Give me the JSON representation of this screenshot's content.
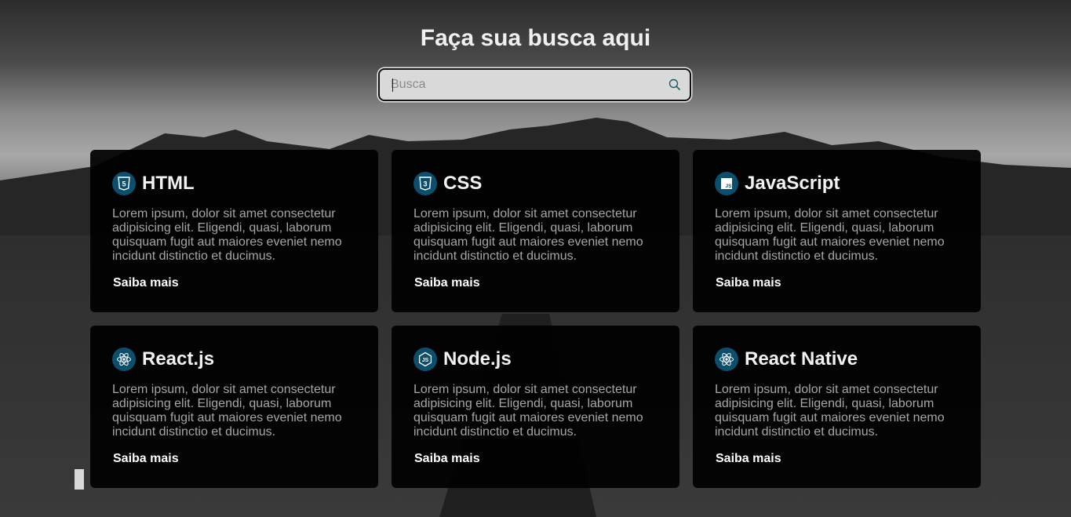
{
  "header": {
    "title": "Faça sua busca aqui"
  },
  "search": {
    "placeholder": "Busca",
    "value": "",
    "icon": "search-icon"
  },
  "cards": [
    {
      "title": "HTML",
      "icon": "html5-icon",
      "text": "Lorem ipsum, dolor sit amet consectetur adipisicing elit. Eligendi, quasi, laborum quisquam fugit aut maiores eveniet nemo incidunt distinctio et ducimus.",
      "link": "Saiba mais"
    },
    {
      "title": "CSS",
      "icon": "css3-icon",
      "text": "Lorem ipsum, dolor sit amet consectetur adipisicing elit. Eligendi, quasi, laborum quisquam fugit aut maiores eveniet nemo incidunt distinctio et ducimus.",
      "link": "Saiba mais"
    },
    {
      "title": "JavaScript",
      "icon": "javascript-icon",
      "text": "Lorem ipsum, dolor sit amet consectetur adipisicing elit. Eligendi, quasi, laborum quisquam fugit aut maiores eveniet nemo incidunt distinctio et ducimus.",
      "link": "Saiba mais"
    },
    {
      "title": "React.js",
      "icon": "react-icon",
      "text": "Lorem ipsum, dolor sit amet consectetur adipisicing elit. Eligendi, quasi, laborum quisquam fugit aut maiores eveniet nemo incidunt distinctio et ducimus.",
      "link": "Saiba mais"
    },
    {
      "title": "Node.js",
      "icon": "nodejs-icon",
      "text": "Lorem ipsum, dolor sit amet consectetur adipisicing elit. Eligendi, quasi, laborum quisquam fugit aut maiores eveniet nemo incidunt distinctio et ducimus.",
      "link": "Saiba mais"
    },
    {
      "title": "React Native",
      "icon": "react-native-icon",
      "text": "Lorem ipsum, dolor sit amet consectetur adipisicing elit. Eligendi, quasi, laborum quisquam fugit aut maiores eveniet nemo incidunt distinctio et ducimus.",
      "link": "Saiba mais"
    }
  ],
  "colors": {
    "card_bg": "#000000",
    "icon_bg": "#0c4f6d",
    "title": "#f2f2f2",
    "body_text": "#a6a6a6",
    "link": "#ffffff"
  }
}
